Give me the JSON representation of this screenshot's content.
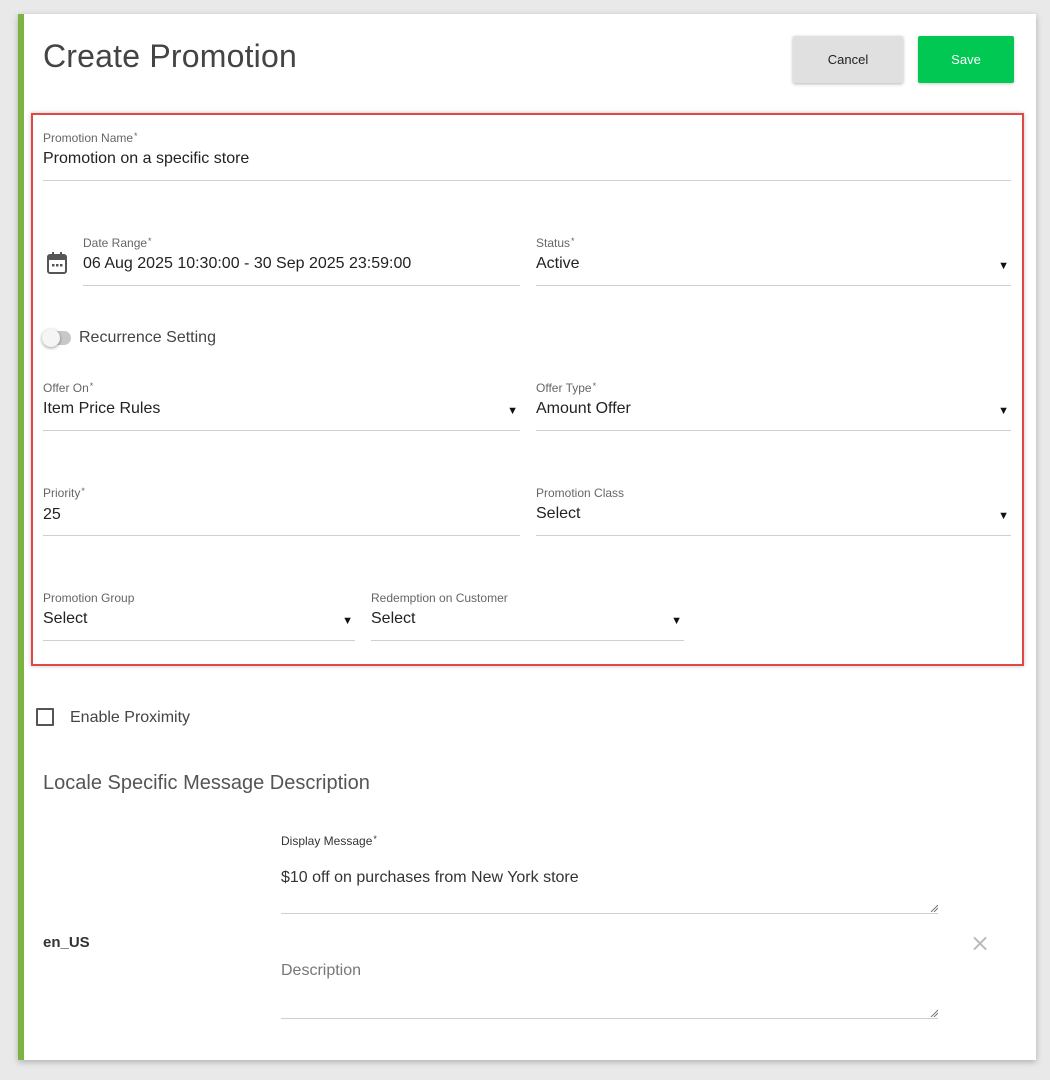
{
  "header": {
    "title": "Create Promotion",
    "cancel_label": "Cancel",
    "save_label": "Save"
  },
  "form": {
    "promotion_name": {
      "label": "Promotion Name",
      "required": "*",
      "value": "Promotion on a specific store"
    },
    "date_range": {
      "label": "Date Range",
      "required": "*",
      "value": "06 Aug 2025 10:30:00 - 30 Sep 2025 23:59:00"
    },
    "status": {
      "label": "Status",
      "required": "*",
      "value": "Active"
    },
    "recurrence": {
      "label": "Recurrence Setting",
      "enabled": false
    },
    "offer_on": {
      "label": "Offer On",
      "required": "*",
      "value": "Item Price Rules"
    },
    "offer_type": {
      "label": "Offer Type",
      "required": "*",
      "value": "Amount Offer"
    },
    "priority": {
      "label": "Priority",
      "required": "*",
      "value": "25"
    },
    "promotion_class": {
      "label": "Promotion Class",
      "value": "Select"
    },
    "promotion_group": {
      "label": "Promotion Group",
      "value": "Select"
    },
    "redemption_on_customer": {
      "label": "Redemption on Customer",
      "value": "Select"
    },
    "dropdown_arrow": "▼"
  },
  "proximity": {
    "label": "Enable Proximity",
    "checked": false
  },
  "locale_section": {
    "title": "Locale Specific Message Description",
    "locale": "en_US",
    "display_message": {
      "label": "Display Message",
      "required": "*",
      "value": "$10 off on purchases from New York store"
    },
    "description": {
      "placeholder": "Description"
    },
    "remove_glyph": "×"
  },
  "colors": {
    "accent_bar": "#7cb342",
    "save_button": "#00c853",
    "highlight_border": "#e04848"
  }
}
